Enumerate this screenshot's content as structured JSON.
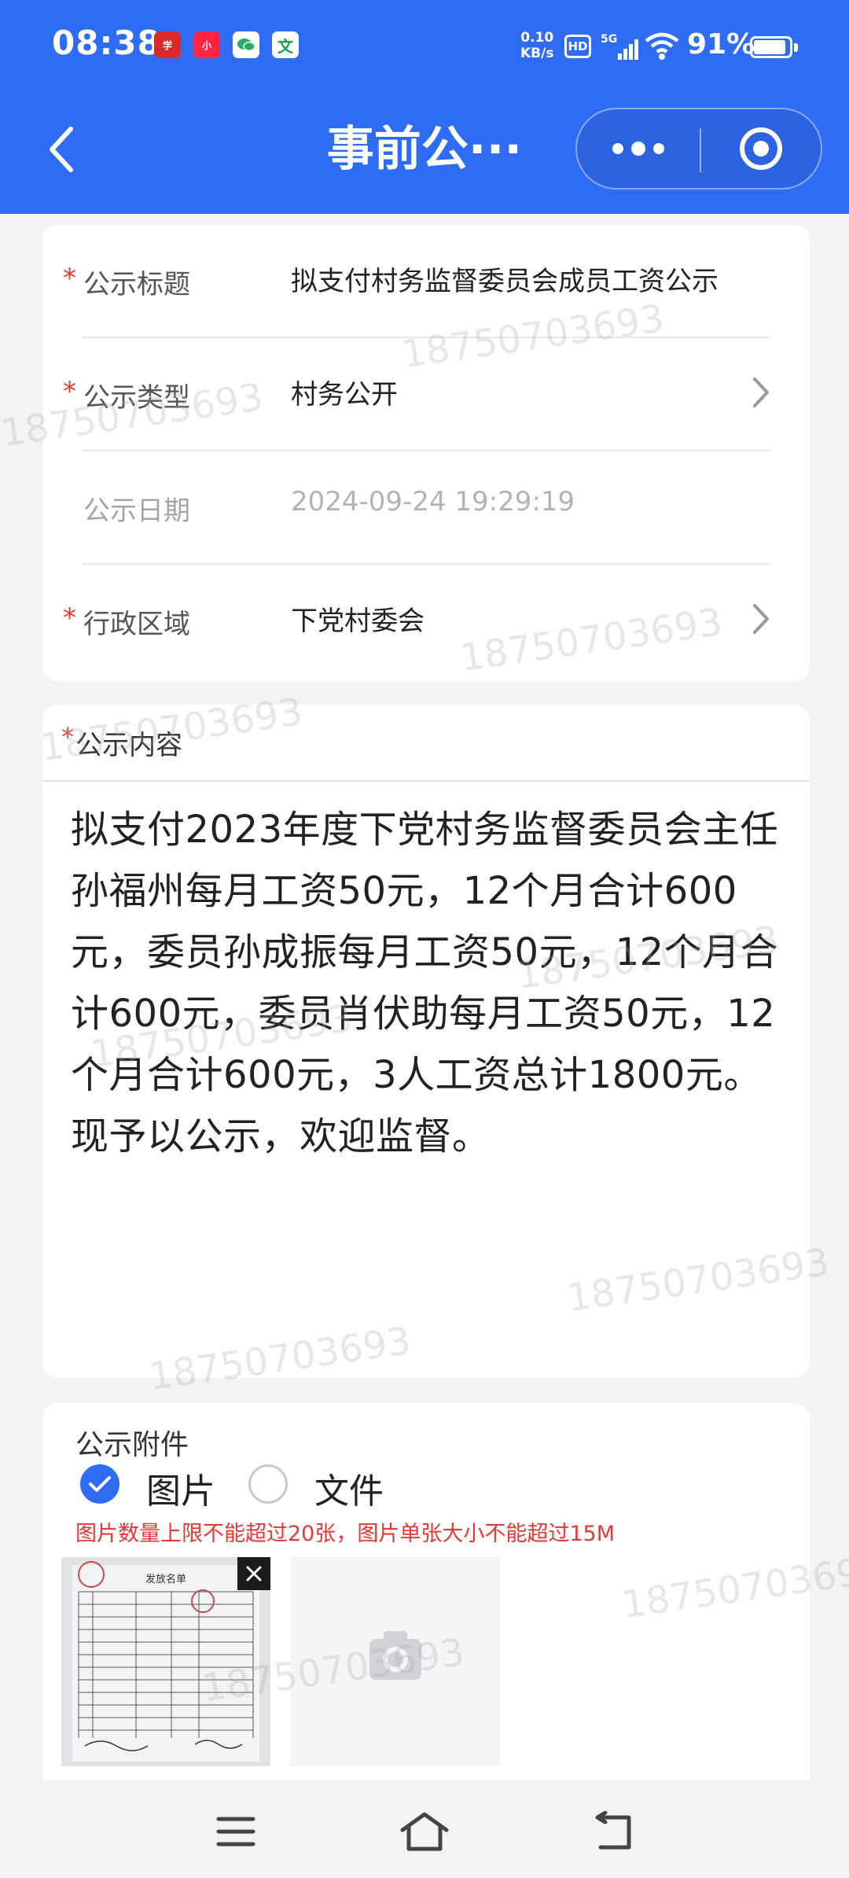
{
  "status_bar": {
    "time": "08:38",
    "net_speed_value": "0.10",
    "net_speed_unit": "KB/s",
    "hd": "HD",
    "network": "5G",
    "battery_percent": "91%",
    "battery_level": 0.91,
    "app_icons": [
      "学习强国",
      "小红书",
      "微信",
      "文"
    ]
  },
  "header": {
    "title": "事前公···",
    "back_icon": "chevron-left-icon",
    "more_icon": "more-dots-icon",
    "close_icon": "target-circle-icon",
    "bg_color": "#2f6cf5"
  },
  "form": {
    "rows": [
      {
        "label": "公示标题",
        "value": "拟支付村务监督委员会成员工资公示",
        "required": true
      },
      {
        "label": "公示类型",
        "value": "村务公开",
        "required": true,
        "has_arrow": true
      },
      {
        "label": "公示日期",
        "value": "2024-09-24 19:29:19",
        "required": false,
        "muted": true
      },
      {
        "label": "行政区域",
        "value": "下党村委会",
        "required": true,
        "has_arrow": true
      }
    ]
  },
  "content": {
    "label": "公示内容",
    "required_mark": "*",
    "text": "拟支付2023年度下党村务监督委员会主任孙福州每月工资50元，12个月合计600元，委员孙成振每月工资50元，12个月合计600元，委员肖伏助每月工资50元，12个月合计600元，3人工资总计1800元。现予以公示，欢迎监督。"
  },
  "attachment": {
    "title": "公示附件",
    "options": [
      {
        "label": "图片",
        "checked": true
      },
      {
        "label": "文件",
        "checked": false
      }
    ],
    "limit_note": "图片数量上限不能超过20张，图片单张大小不能超过15M",
    "photo_title": "发放名单"
  },
  "watermark": "18750703693",
  "nav": {
    "menu_icon": "menu-icon",
    "home_icon": "home-icon",
    "back_icon": "back-icon"
  }
}
